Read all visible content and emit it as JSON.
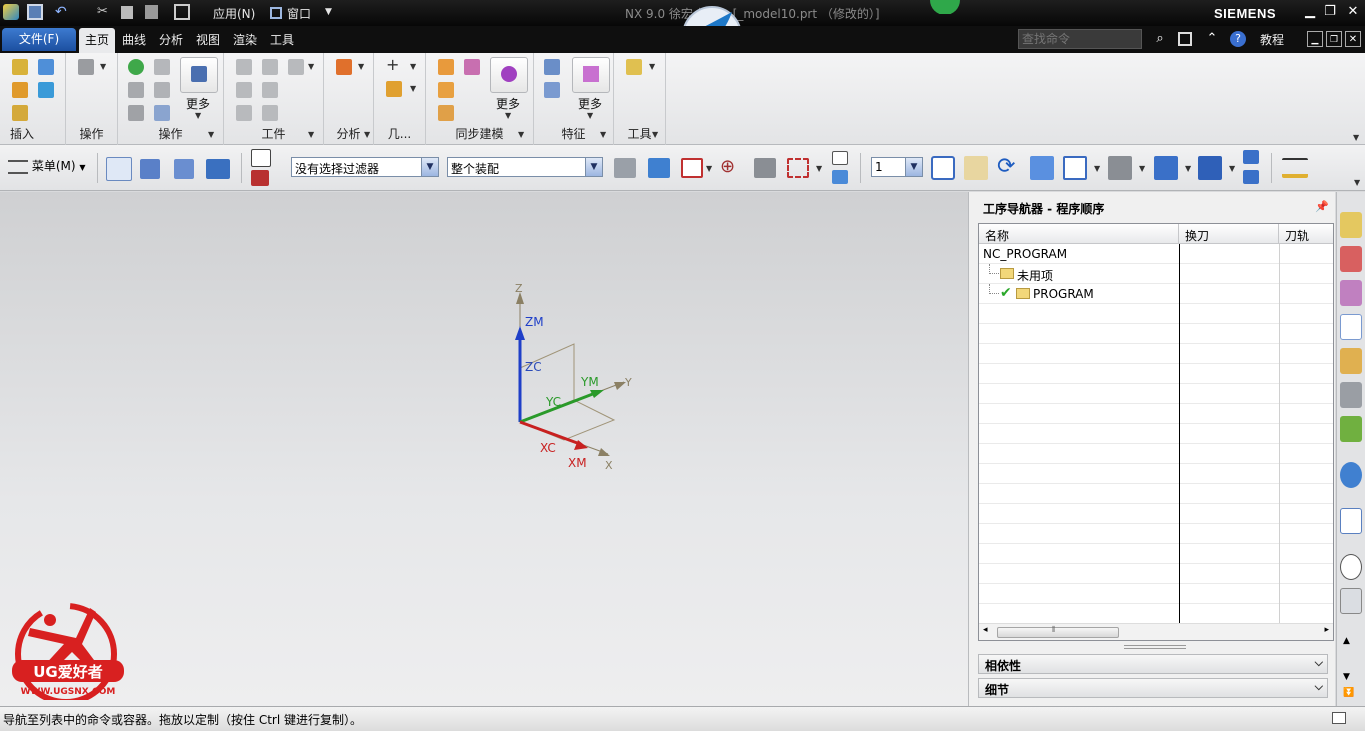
{
  "titlebar": {
    "document_title": "NX 9.0 徐宏    加工 - [_model10.prt （修改的）]",
    "brand": "SIEMENS",
    "app_menu": "应用(N)",
    "window_menu": "窗口"
  },
  "menubar": {
    "file_tab": "文件(F)",
    "tabs": [
      "主页",
      "曲线",
      "分析",
      "视图",
      "渲染",
      "工具"
    ],
    "search_placeholder": "查找命令",
    "tutorial": "教程"
  },
  "ribbon": {
    "groups": [
      "插入",
      "操作",
      "操作",
      "工件",
      "分析",
      "几...",
      "同步建模",
      "特征",
      "工具"
    ],
    "more_label": "更多"
  },
  "toolbar": {
    "menu_label": "菜单(M)",
    "selection_filter": "没有选择过滤器",
    "assembly_scope": "整个装配",
    "layer_value": "1"
  },
  "triad": {
    "labels": [
      "Z",
      "ZM",
      "ZC",
      "YM",
      "Y",
      "YC",
      "XC",
      "XM",
      "X"
    ]
  },
  "navigator": {
    "title": "工序导航器 - 程序顺序",
    "columns": [
      "名称",
      "换刀",
      "刀轨"
    ],
    "rows": [
      {
        "name": "NC_PROGRAM",
        "level": 0
      },
      {
        "name": "未用项",
        "level": 1
      },
      {
        "name": "PROGRAM",
        "level": 1,
        "checked": true
      }
    ],
    "sections": [
      "相依性",
      "细节"
    ]
  },
  "logo": {
    "text": "UG爱好者",
    "url": "WWW.UGSNX.COM"
  },
  "statusbar": {
    "message": "导航至列表中的命令或容器。拖放以定制（按住 Ctrl 键进行复制）。"
  },
  "colors": {
    "accent": "#1c4fa0",
    "z_axis": "#1f3fc8",
    "y_axis": "#2a9a2a",
    "x_axis": "#c82020"
  }
}
